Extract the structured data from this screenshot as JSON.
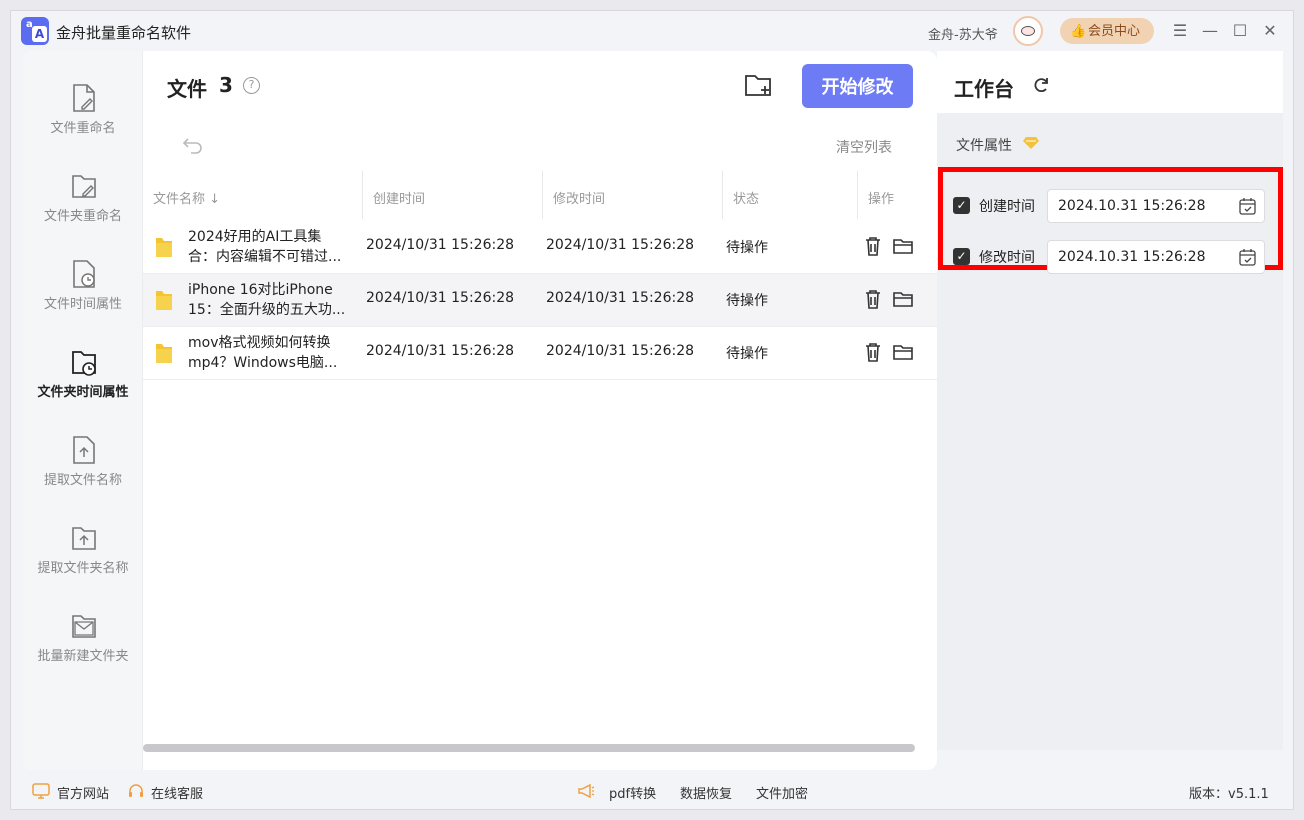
{
  "app": {
    "title": "金舟批量重命名软件",
    "logo_letters": [
      "a",
      "A"
    ],
    "username": "金舟-苏大爷",
    "vip_label": "会员中心"
  },
  "sidebar": {
    "items": [
      {
        "label": "文件重命名",
        "icon": "file-edit-icon",
        "active": false
      },
      {
        "label": "文件夹重命名",
        "icon": "folder-edit-icon",
        "active": false
      },
      {
        "label": "文件时间属性",
        "icon": "file-clock-icon",
        "active": false
      },
      {
        "label": "文件夹时间属性",
        "icon": "folder-clock-icon",
        "active": true
      },
      {
        "label": "提取文件名称",
        "icon": "file-extract-icon",
        "active": false
      },
      {
        "label": "提取文件夹名称",
        "icon": "folder-extract-icon",
        "active": false
      },
      {
        "label": "批量新建文件夹",
        "icon": "folder-new-icon",
        "active": false
      }
    ]
  },
  "files": {
    "title": "文件",
    "count": "3",
    "help": "?",
    "start_label": "开始修改",
    "clear_label": "清空列表",
    "columns": [
      "文件名称",
      "创建时间",
      "修改时间",
      "状态",
      "操作"
    ],
    "rows": [
      {
        "name_line1": "2024好用的AI工具集",
        "name_line2": "合：内容编辑不可错过...",
        "created": "2024/10/31 15:26:28",
        "modified": "2024/10/31 15:26:28",
        "status": "待操作"
      },
      {
        "name_line1": "iPhone 16对比iPhone",
        "name_line2": "15：全面升级的五大功...",
        "created": "2024/10/31 15:26:28",
        "modified": "2024/10/31 15:26:28",
        "status": "待操作"
      },
      {
        "name_line1": "mov格式视频如何转换",
        "name_line2": "mp4？Windows电脑...",
        "created": "2024/10/31 15:26:28",
        "modified": "2024/10/31 15:26:28",
        "status": "待操作"
      }
    ]
  },
  "workbench": {
    "title": "工作台",
    "section_label": "文件属性",
    "options": [
      {
        "label": "创建时间",
        "checked": true,
        "value": "2024.10.31 15:26:28"
      },
      {
        "label": "修改时间",
        "checked": true,
        "value": "2024.10.31 15:26:28"
      }
    ]
  },
  "footer": {
    "website": "官方网站",
    "support": "在线客服",
    "pdf": "pdf转换",
    "recovery": "数据恢复",
    "encrypt": "文件加密",
    "version": "版本：v5.1.1"
  },
  "colors": {
    "accent": "#6d7bf4",
    "highlight_box": "#ff0000",
    "vip_bg": "#f1d3b3",
    "folder": "#f5c431"
  }
}
